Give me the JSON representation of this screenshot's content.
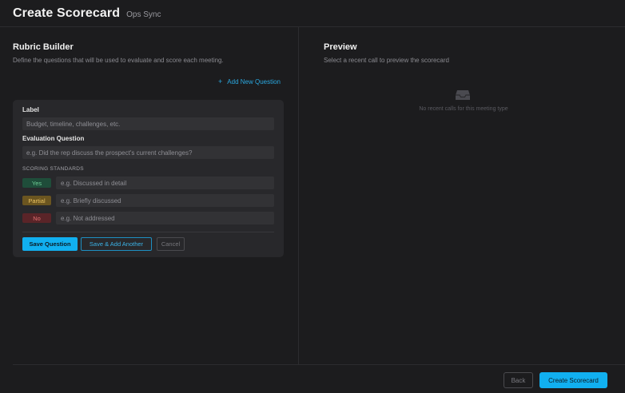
{
  "header": {
    "title": "Create Scorecard",
    "subtitle": "Ops Sync"
  },
  "rubric": {
    "title": "Rubric Builder",
    "description": "Define the questions that will be used to evaluate and score each meeting.",
    "add_question": "Add New Question",
    "form": {
      "label_heading": "Label",
      "label_placeholder": "Budget, timeline, challenges, etc.",
      "question_heading": "Evaluation Question",
      "question_placeholder": "e.g. Did the rep discuss the prospect's current challenges?",
      "scoring_heading": "SCORING STANDARDS",
      "standards": [
        {
          "badge": "Yes",
          "placeholder": "e.g. Discussed in detail",
          "color": "#6fcf97"
        },
        {
          "badge": "Partial",
          "placeholder": "e.g. Briefly discussed",
          "color": "#e8c060"
        },
        {
          "badge": "No",
          "placeholder": "e.g. Not addressed",
          "color": "#e07070"
        }
      ],
      "save_label": "Save Question",
      "save_add_label": "Save & Add Another",
      "cancel_label": "Cancel"
    }
  },
  "preview": {
    "title": "Preview",
    "description": "Select a recent call to preview the scorecard",
    "empty_icon": "inbox-icon",
    "empty_text": "No recent calls for this meeting type"
  },
  "footer": {
    "back_label": "Back",
    "create_label": "Create Scorecard"
  },
  "colors": {
    "accent": "#11b0f0",
    "background": "#1c1c1e",
    "card": "#28282b"
  }
}
